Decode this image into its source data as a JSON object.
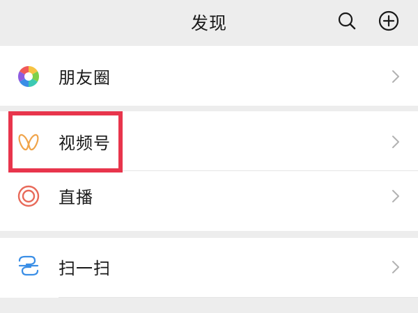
{
  "header": {
    "title": "发现",
    "search_icon": "search-icon",
    "add_icon": "plus-circle-icon"
  },
  "menu": {
    "moments": {
      "label": "朋友圈",
      "icon": "moments-aperture-icon"
    },
    "channels": {
      "label": "视频号",
      "icon": "channels-butterfly-icon"
    },
    "live": {
      "label": "直播",
      "icon": "live-ring-icon"
    },
    "scan": {
      "label": "扫一扫",
      "icon": "scan-icon"
    }
  },
  "colors": {
    "background": "#ededed",
    "row": "#ffffff",
    "text": "#191919",
    "chevron": "#b2b2b2",
    "highlight": "#e8354c",
    "channels_icon": "#f0a44a",
    "live_icon": "#e86a5a",
    "scan_icon": "#3a8ee6"
  }
}
